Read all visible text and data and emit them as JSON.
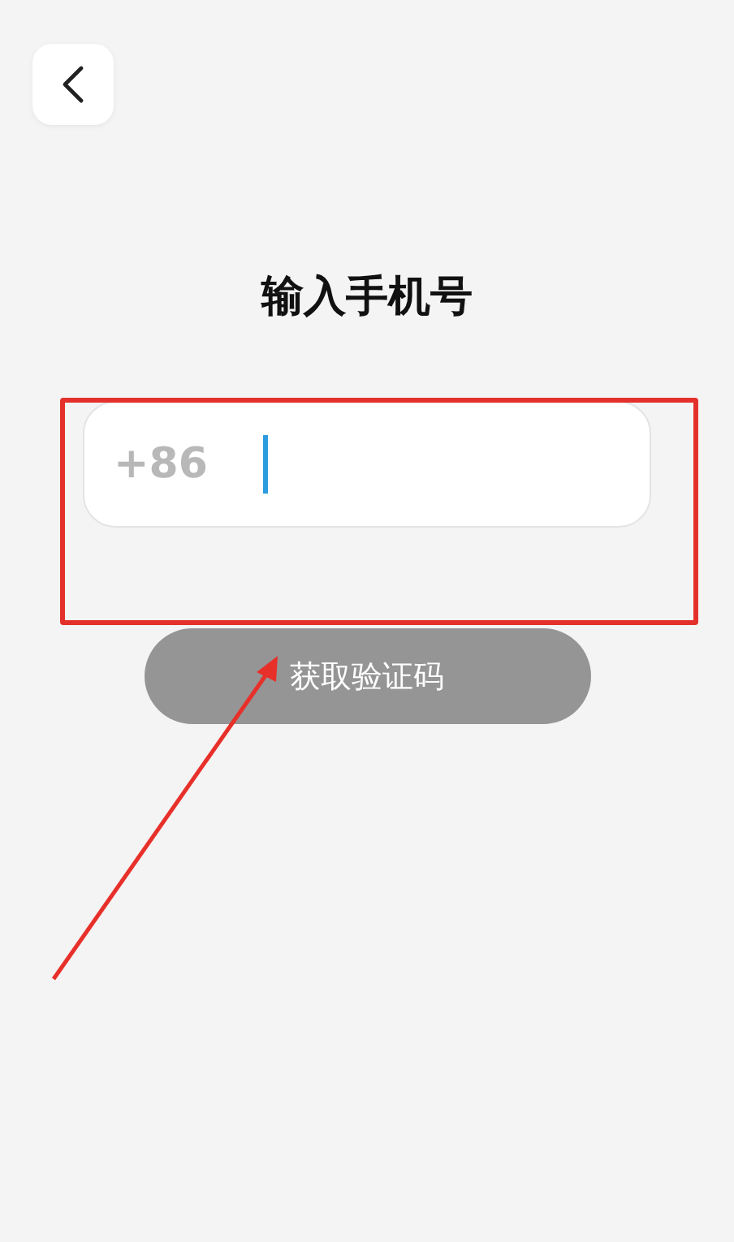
{
  "title": "输入手机号",
  "phone_field": {
    "country_code": "+86",
    "focused": true
  },
  "submit_button": {
    "label": "获取验证码",
    "disabled": true
  }
}
